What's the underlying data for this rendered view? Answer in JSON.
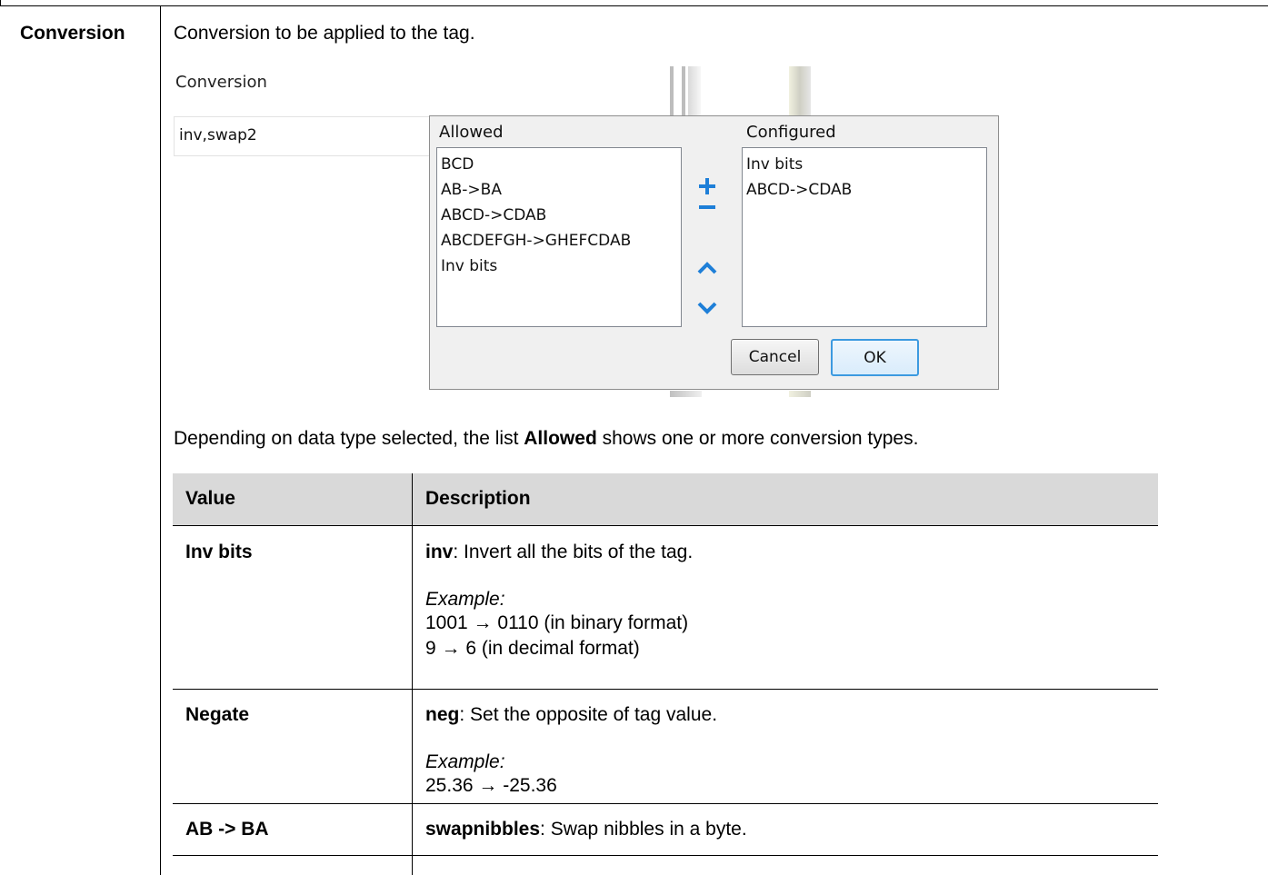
{
  "param": {
    "name": "Conversion",
    "description": "Conversion to be applied to the tag."
  },
  "screenshot": {
    "field_label": "Conversion",
    "field_value": "inv,swap2",
    "dialog": {
      "allowed_label": "Allowed",
      "configured_label": "Configured",
      "allowed_items": [
        "BCD",
        "AB->BA",
        "ABCD->CDAB",
        "ABCDEFGH->GHEFCDAB",
        "Inv bits"
      ],
      "configured_items": [
        "Inv bits",
        "ABCD->CDAB"
      ],
      "cancel_label": "Cancel",
      "ok_label": "OK",
      "icons": [
        "plus-icon",
        "minus-icon",
        "chevron-up-icon",
        "chevron-down-icon"
      ],
      "icon_color": "#1e7fd8"
    }
  },
  "paragraph": {
    "before": "Depending on data type selected, the list ",
    "bold": "Allowed",
    "after": " shows one or more conversion types."
  },
  "table": {
    "headers": [
      "Value",
      "Description"
    ],
    "header_bg": "#d9d9d9",
    "rows": [
      {
        "value": "Inv bits",
        "keyword": "inv",
        "desc": ": Invert all the bits of the tag.",
        "example_label": "Example:",
        "examples": [
          "1001 → 0110 (in binary format)",
          "9 → 6 (in decimal format)"
        ]
      },
      {
        "value": "Negate",
        "keyword": "neg",
        "desc": ": Set the opposite of tag value.",
        "example_label": "Example:",
        "examples": [
          "25.36 → -25.36"
        ]
      },
      {
        "value": "AB -> BA",
        "keyword": "swapnibbles",
        "desc": ": Swap nibbles in a byte."
      }
    ]
  }
}
